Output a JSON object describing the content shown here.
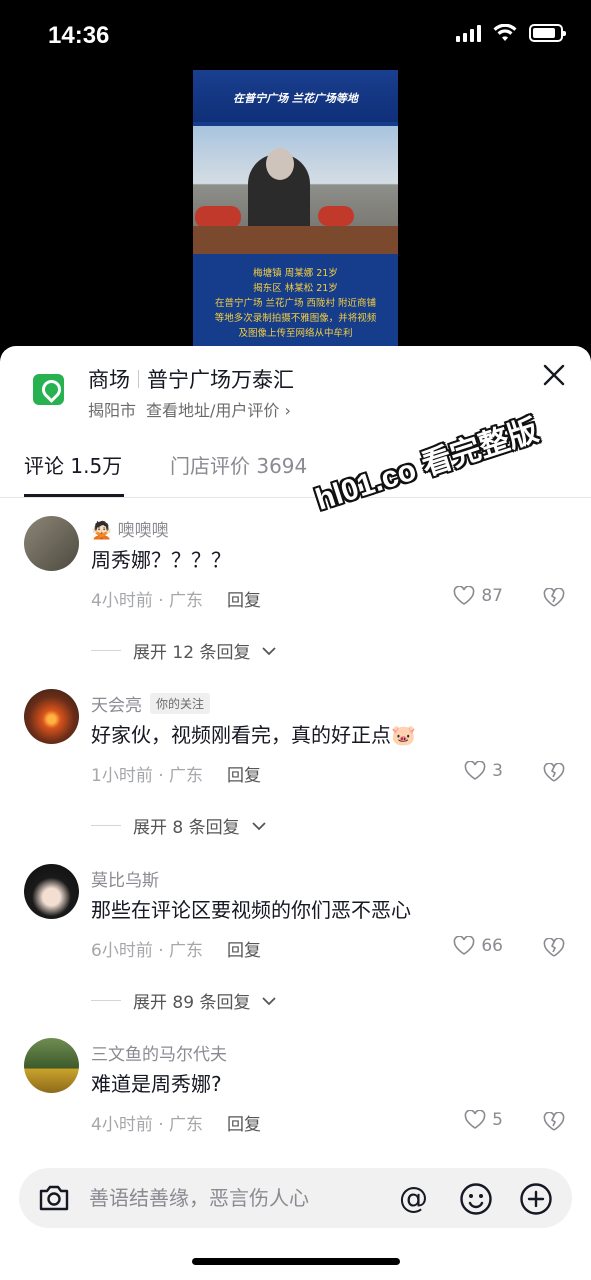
{
  "status_bar": {
    "time": "14:36"
  },
  "video": {
    "top_caption": "在普宁广场  兰花广场等地",
    "lines": [
      "梅塘镇 周某娜 21岁",
      "揭东区 林某松 21岁",
      "在普宁广场 兰花广场 西陇村 附近商铺",
      "等地多次录制拍摄不雅图像，并将视频",
      "及图像上传至网络从中牟利"
    ]
  },
  "header": {
    "category": "商场",
    "shop_name": "普宁广场万泰汇",
    "city": "揭阳市",
    "link": "查看地址/用户评价 ›",
    "accent": "#27b150"
  },
  "tabs": [
    {
      "label": "评论 1.5万",
      "active": true
    },
    {
      "label": "门店评价 3694",
      "active": false
    }
  ],
  "comments": [
    {
      "name": "🙅🏻 噢噢噢",
      "badge": "",
      "text": "周秀娜？？？？",
      "time": "4小时前 · 广东",
      "reply": "回复",
      "likes": "87",
      "expand": "展开 12 条回复"
    },
    {
      "name": "天会亮",
      "badge": "你的关注",
      "text": "好家伙，视频刚看完，真的好正点🐷",
      "time": "1小时前 · 广东",
      "reply": "回复",
      "likes": "3",
      "expand": "展开 8 条回复"
    },
    {
      "name": "莫比乌斯",
      "badge": "",
      "text": "那些在评论区要视频的你们恶不恶心",
      "time": "6小时前 · 广东",
      "reply": "回复",
      "likes": "66",
      "expand": "展开 89 条回复"
    },
    {
      "name": "三文鱼的马尔代夫",
      "badge": "",
      "text": "难道是周秀娜?",
      "time": "4小时前 · 广东",
      "reply": "回复",
      "likes": "5",
      "expand": ""
    }
  ],
  "input": {
    "placeholder": "善语结善缘，恶言伤人心"
  },
  "watermark": "hl01.co 看完整版"
}
